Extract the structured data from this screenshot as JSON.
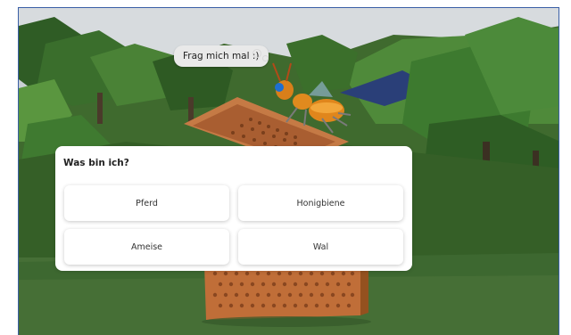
{
  "speech_bubble": {
    "text": "Frag mich mal :)"
  },
  "quiz": {
    "question": "Was bin ich?",
    "answers": [
      {
        "label": "Pferd"
      },
      {
        "label": "Honigbiene"
      },
      {
        "label": "Ameise"
      },
      {
        "label": "Wal"
      }
    ]
  },
  "colors": {
    "sky": "#c7cdd2",
    "foliage_dark": "#2f5a24",
    "foliage_mid": "#4a7d34",
    "ground": "#3c6a2d",
    "bee_hotel_wood": "#b7693a",
    "bee_body": "#e08a1e",
    "panel": "#ffffff",
    "frame_border": "#3a5fa6"
  }
}
